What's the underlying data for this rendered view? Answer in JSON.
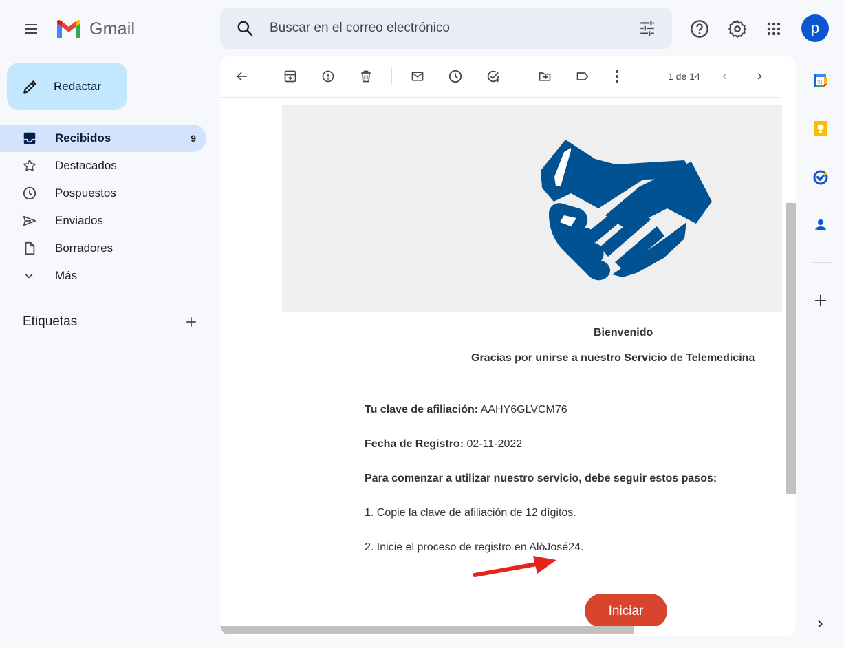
{
  "app": {
    "name": "Gmail"
  },
  "search": {
    "placeholder": "Buscar en el correo electrónico"
  },
  "account": {
    "initial": "p"
  },
  "compose": {
    "label": "Redactar"
  },
  "sidebar": {
    "items": [
      {
        "label": "Recibidos",
        "count": "9",
        "icon": "inbox-icon",
        "active": true
      },
      {
        "label": "Destacados",
        "icon": "star-icon"
      },
      {
        "label": "Pospuestos",
        "icon": "clock-icon"
      },
      {
        "label": "Enviados",
        "icon": "send-icon"
      },
      {
        "label": "Borradores",
        "icon": "draft-icon"
      },
      {
        "label": "Más",
        "icon": "chevron-down-icon"
      }
    ],
    "labels_title": "Etiquetas"
  },
  "toolbar": {
    "pager": "1 de 14"
  },
  "email": {
    "welcome": "Bienvenido",
    "thanks": "Gracias por unirse a nuestro Servicio de Telemedicina",
    "key_label": "Tu clave de afiliación:",
    "key_value": "AAHY6GLVCM76",
    "date_label": "Fecha de Registro:",
    "date_value": "02-11-2022",
    "steps_intro": "Para comenzar a utilizar nuestro servicio, debe seguir estos pasos:",
    "step1": "1. Copie la clave de afiliación de 12 dígitos.",
    "step2": "2. Inicie el proceso de registro en AlóJosé24.",
    "start_button": "Iniciar"
  },
  "colors": {
    "accent": "#0b57d0",
    "compose_bg": "#c2e7ff",
    "active_nav_bg": "#d3e3fd",
    "brand_blue": "#005293",
    "start_button": "#d9442f",
    "annotation_arrow": "#e8231e"
  }
}
